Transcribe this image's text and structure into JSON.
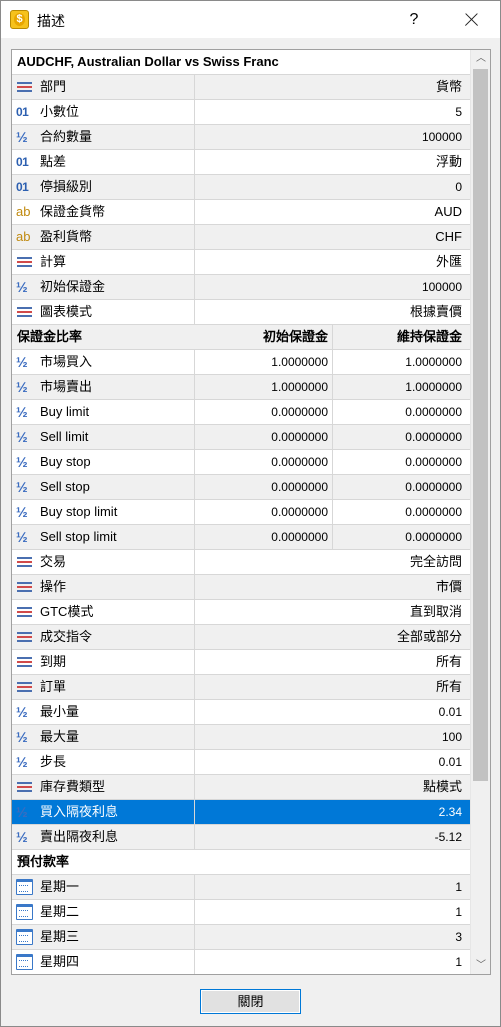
{
  "window": {
    "title": "描述",
    "help_label": "?",
    "close_button_label": "關閉"
  },
  "header": {
    "symbol_title": "AUDCHF, Australian Dollar vs Swiss Franc"
  },
  "properties": [
    {
      "icon": "list",
      "name": "部門",
      "value": "貨幣",
      "shade": true
    },
    {
      "icon": "num",
      "name": "小數位",
      "value": "5",
      "shade": false
    },
    {
      "icon": "half",
      "name": "合約數量",
      "value": "100000",
      "shade": true
    },
    {
      "icon": "num",
      "name": "點差",
      "value": "浮動",
      "shade": false
    },
    {
      "icon": "num",
      "name": "停損級別",
      "value": "0",
      "shade": true
    },
    {
      "icon": "ab",
      "name": "保證金貨幣",
      "value": "AUD",
      "shade": false
    },
    {
      "icon": "ab",
      "name": "盈利貨幣",
      "value": "CHF",
      "shade": true
    },
    {
      "icon": "list",
      "name": "計算",
      "value": "外匯",
      "shade": false
    },
    {
      "icon": "half",
      "name": "初始保證金",
      "value": "100000",
      "shade": true
    },
    {
      "icon": "list",
      "name": "圖表模式",
      "value": "根據賣價",
      "shade": false
    }
  ],
  "margin_table": {
    "title": "保證金比率",
    "col_initial": "初始保證金",
    "col_maintenance": "維持保證金",
    "rows": [
      {
        "name": "市場買入",
        "initial": "1.0000000",
        "maintenance": "1.0000000",
        "shade": false
      },
      {
        "name": "市場賣出",
        "initial": "1.0000000",
        "maintenance": "1.0000000",
        "shade": true
      },
      {
        "name": "Buy limit",
        "initial": "0.0000000",
        "maintenance": "0.0000000",
        "shade": false
      },
      {
        "name": "Sell limit",
        "initial": "0.0000000",
        "maintenance": "0.0000000",
        "shade": true
      },
      {
        "name": "Buy stop",
        "initial": "0.0000000",
        "maintenance": "0.0000000",
        "shade": false
      },
      {
        "name": "Sell stop",
        "initial": "0.0000000",
        "maintenance": "0.0000000",
        "shade": true
      },
      {
        "name": "Buy stop limit",
        "initial": "0.0000000",
        "maintenance": "0.0000000",
        "shade": false
      },
      {
        "name": "Sell stop limit",
        "initial": "0.0000000",
        "maintenance": "0.0000000",
        "shade": true
      }
    ]
  },
  "trading": [
    {
      "icon": "list",
      "name": "交易",
      "value": "完全訪問",
      "shade": false
    },
    {
      "icon": "list",
      "name": "操作",
      "value": "市價",
      "shade": true
    },
    {
      "icon": "list",
      "name": "GTC模式",
      "value": "直到取消",
      "shade": false
    },
    {
      "icon": "list",
      "name": "成交指令",
      "value": "全部或部分",
      "shade": true
    },
    {
      "icon": "list",
      "name": "到期",
      "value": "所有",
      "shade": false
    },
    {
      "icon": "list",
      "name": "訂單",
      "value": "所有",
      "shade": true
    },
    {
      "icon": "half",
      "name": "最小量",
      "value": "0.01",
      "shade": false
    },
    {
      "icon": "half",
      "name": "最大量",
      "value": "100",
      "shade": true
    },
    {
      "icon": "half",
      "name": "步長",
      "value": "0.01",
      "shade": false
    },
    {
      "icon": "list",
      "name": "庫存費類型",
      "value": "點模式",
      "shade": true
    },
    {
      "icon": "half",
      "name": "買入隔夜利息",
      "value": "2.34",
      "shade": false,
      "selected": true
    },
    {
      "icon": "half",
      "name": "賣出隔夜利息",
      "value": "-5.12",
      "shade": true
    }
  ],
  "prepayment": {
    "title": "預付款率",
    "rows": [
      {
        "name": "星期一",
        "value": "1",
        "shade": true
      },
      {
        "name": "星期二",
        "value": "1",
        "shade": false
      },
      {
        "name": "星期三",
        "value": "3",
        "shade": true
      },
      {
        "name": "星期四",
        "value": "1",
        "shade": false
      }
    ]
  },
  "colors": {
    "selection": "#0078d7",
    "row_shade": "#f0f0f0",
    "grid_line": "#d7d7d7"
  },
  "icons": {
    "list": "list-icon",
    "num": "integer-icon",
    "half": "decimal-icon",
    "ab": "string-icon",
    "cal": "calendar-icon"
  }
}
